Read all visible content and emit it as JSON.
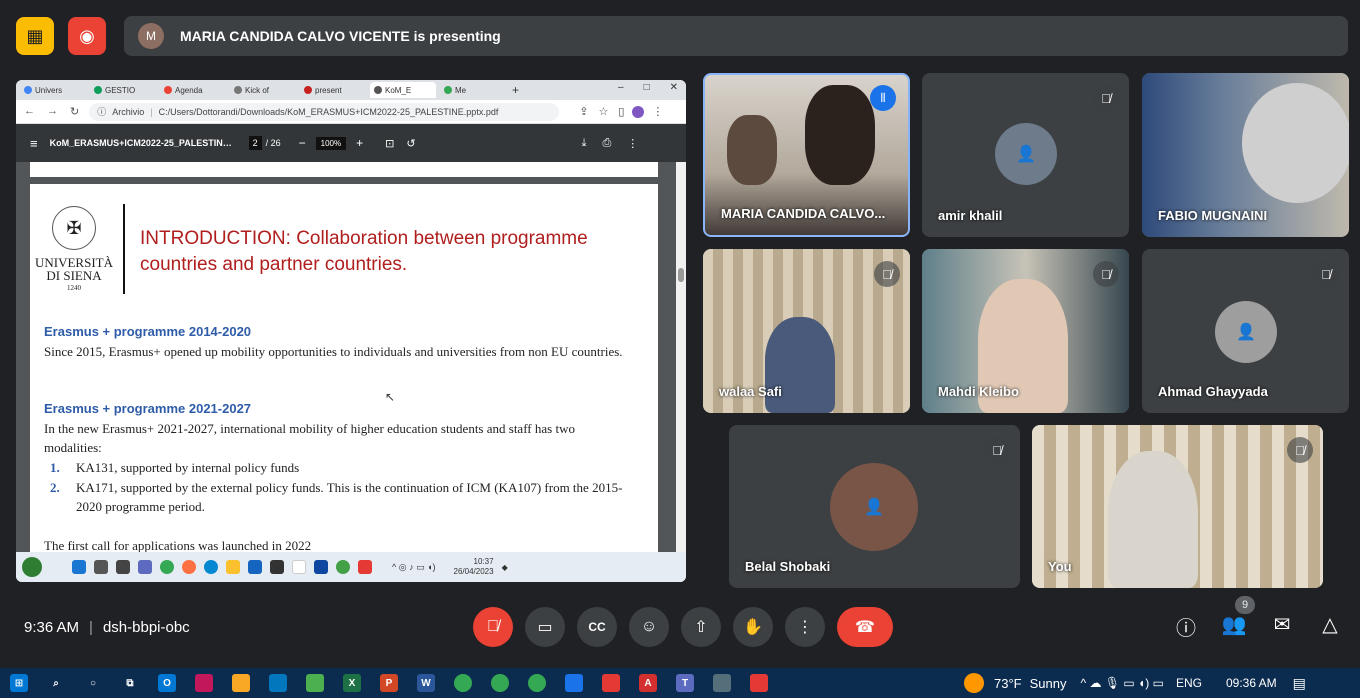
{
  "presenter_banner": {
    "text": "MARIA CANDIDA CALVO VICENTE is presenting"
  },
  "browser": {
    "tabs": [
      "Univers",
      "GESTIO",
      "Agenda",
      "Kick of",
      "present",
      "KoM_E",
      "Me"
    ],
    "address_label": "Archivio",
    "url": "C:/Users/Dottorandi/Downloads/KoM_ERASMUS+ICM2022-25_PALESTINE.pptx.pdf"
  },
  "pdf_toolbar": {
    "filename": "KoM_ERASMUS+ICM2022-25_PALESTINE...",
    "page": "2",
    "page_total": "/ 26",
    "zoom": "100%",
    "minus": "−",
    "plus": "+"
  },
  "slide": {
    "logo_line1": "UNIVERSITÀ",
    "logo_line2": "DI SIENA",
    "logo_year": "1240",
    "title": "INTRODUCTION: Collaboration between programme countries and partner countries.",
    "sec1_heading": "Erasmus + programme 2014-2020",
    "sec1_text": "Since 2015, Erasmus+ opened up mobility opportunities to individuals and universities from non EU countries.",
    "sec2_heading": "Erasmus + programme 2021-2027",
    "sec2_text": "In the new Erasmus+ 2021-2027, international mobility of higher education students and staff has two modalities:",
    "items": [
      {
        "num": "1.",
        "text": "KA131, supported by internal policy funds"
      },
      {
        "num": "2.",
        "text": "KA171, supported by the external policy funds. This is the continuation of ICM (KA107) from the 2015-2020 programme period."
      }
    ],
    "cut_text": "The first call for applications was launched in 2022"
  },
  "inner_taskbar": {
    "time": "10:37",
    "date": "26/04/2023"
  },
  "participants": [
    {
      "name": "MARIA CANDIDA CALVO..."
    },
    {
      "name": "amir khalil"
    },
    {
      "name": "FABIO MUGNAINI"
    },
    {
      "name": "walaa Safi"
    },
    {
      "name": "Mahdi Kleibo"
    },
    {
      "name": "Ahmad Ghayyada"
    },
    {
      "name": "Belal Shobaki"
    },
    {
      "name": "You"
    }
  ],
  "meeting": {
    "time": "9:36 AM",
    "code": "dsh-bbpi-obc",
    "people_count": "9"
  },
  "windows_taskbar": {
    "weather": "73°F",
    "weather_desc": "Sunny",
    "lang": "ENG",
    "clock": "09:36 AM"
  },
  "colors": {
    "accent": "#8ab4f8",
    "end_call": "#ea4335",
    "background": "#202124"
  }
}
